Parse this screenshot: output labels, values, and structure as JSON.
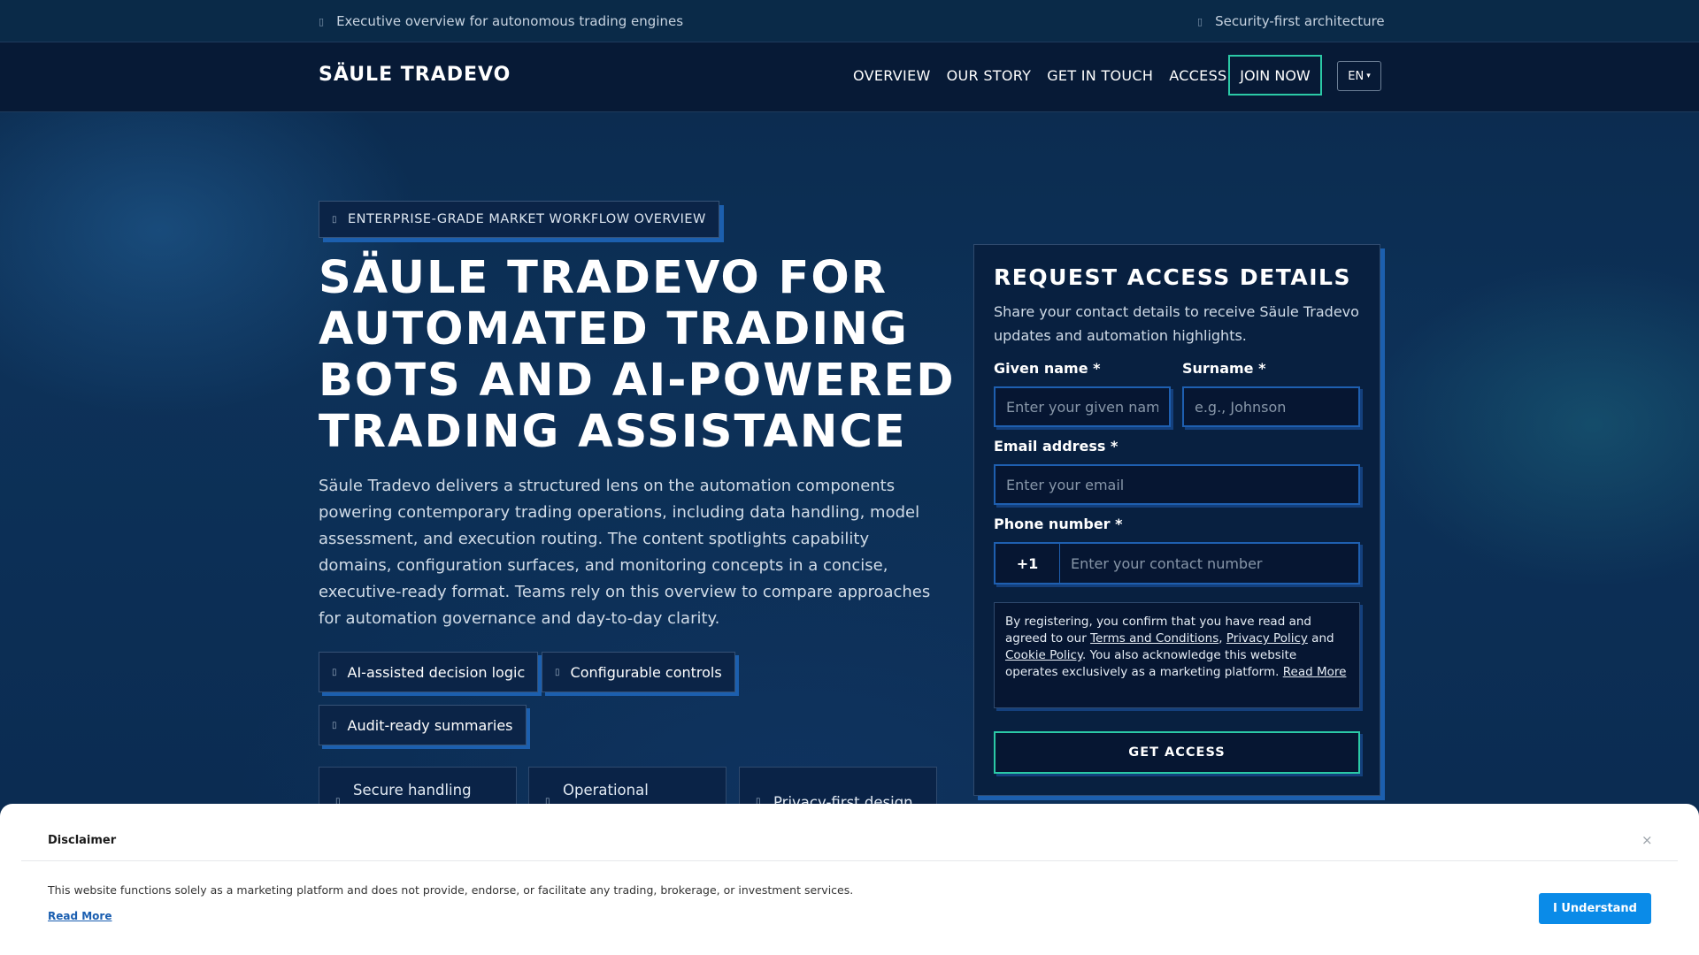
{
  "topbar": {
    "left_text": "Executive overview for autonomous trading engines",
    "right_text": "Security-first architecture",
    "left_icon": "info-square-icon",
    "right_icon": "shield-square-icon"
  },
  "nav": {
    "brand": "SÄULE TRADEVO",
    "links": [
      "OVERVIEW",
      "OUR STORY",
      "GET IN TOUCH",
      "ACCESS"
    ],
    "join_label": "JOIN NOW",
    "lang_label": "EN",
    "lang_caret": "▾"
  },
  "hero": {
    "eyebrow": "ENTERPRISE-GRADE MARKET WORKFLOW OVERVIEW",
    "title": "SÄULE TRADEVO FOR AUTOMATED TRADING BOTS AND AI-POWERED TRADING ASSISTANCE",
    "description": "Säule Tradevo delivers a structured lens on the automation components powering contemporary trading operations, including data handling, model assessment, and execution routing. The content spotlights capability domains, configuration surfaces, and monitoring concepts in a concise, executive-ready format. Teams rely on this overview to compare approaches for automation governance and day-to-day clarity.",
    "chips": [
      "AI-assisted decision logic",
      "Configurable controls",
      "Audit-ready summaries"
    ],
    "features": [
      "Secure handling",
      "Operational",
      "Privacy-first design"
    ]
  },
  "form": {
    "title": "REQUEST ACCESS DETAILS",
    "subtitle": "Share your contact details to receive Säule Tradevo updates and automation highlights.",
    "given_label": "Given name *",
    "given_placeholder": "Enter your given name",
    "surname_label": "Surname *",
    "surname_placeholder": "e.g., Johnson",
    "email_label": "Email address *",
    "email_placeholder": "Enter your email",
    "phone_label": "Phone number *",
    "phone_prefix": "+1",
    "phone_placeholder": "Enter your contact number",
    "consent": {
      "part1": "By registering, you confirm that you have read and agreed to our ",
      "terms": "Terms and Conditions",
      "sep1": ", ",
      "privacy": "Privacy Policy",
      "sep2": " and ",
      "cookie": "Cookie Policy",
      "part2": ". You also acknowledge this website operates exclusively as a marketing platform. ",
      "read_more": "Read More"
    },
    "submit_label": "GET ACCESS"
  },
  "disclaimer": {
    "title": "Disclaimer",
    "close": "×",
    "text": "This website functions solely as a marketing platform and does not provide, endorse, or facilitate any trading, brokerage, or investment services.",
    "read_more": "Read More",
    "button": "I Understand"
  }
}
